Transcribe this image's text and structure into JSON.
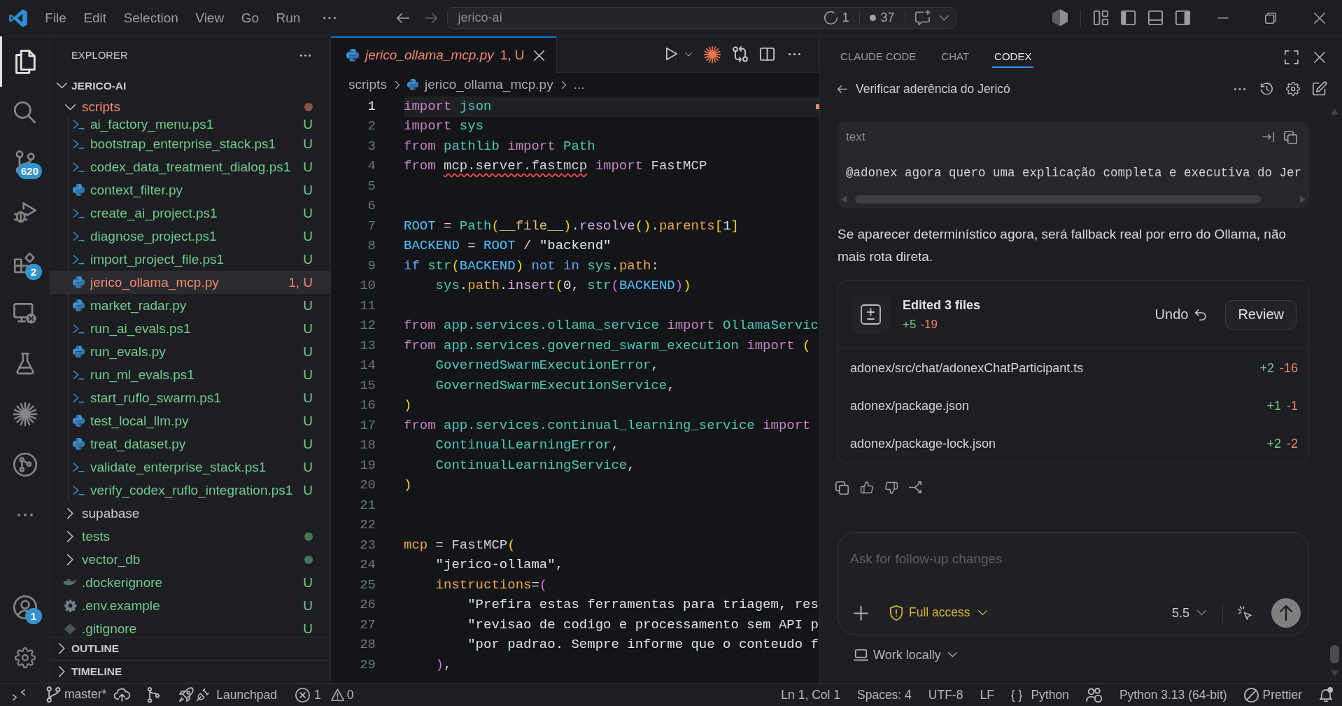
{
  "title_bar": {
    "menu": [
      "File",
      "Edit",
      "Selection",
      "View",
      "Go",
      "Run"
    ],
    "command_center": {
      "text": "jerico-ai",
      "indicators": [
        {
          "kind": "ring",
          "label": "1"
        },
        {
          "kind": "dot",
          "label": "37"
        }
      ]
    }
  },
  "activity_bar": {
    "items": [
      {
        "kind": "files",
        "selected": true
      },
      {
        "kind": "search",
        "selected": false
      },
      {
        "kind": "source-control",
        "selected": false,
        "badge": "620"
      },
      {
        "kind": "run-debug",
        "selected": false
      },
      {
        "kind": "extensions",
        "selected": false,
        "badge": "2"
      },
      {
        "kind": "remote",
        "selected": false
      },
      {
        "kind": "testing",
        "selected": false
      },
      {
        "kind": "starburst",
        "selected": false
      },
      {
        "kind": "graph",
        "selected": false
      },
      {
        "kind": "more",
        "selected": false
      }
    ],
    "bottom_items": [
      {
        "kind": "account",
        "selected": false,
        "badge": "1"
      },
      {
        "kind": "settings",
        "selected": false
      }
    ]
  },
  "explorer": {
    "title": "EXPLORER",
    "root": {
      "label": "JERICO-AI",
      "expanded": true,
      "children": [
        {
          "label": "scripts",
          "kind": "folder",
          "expanded": true,
          "has_changes": true,
          "selected": false,
          "color": "#f48771",
          "children": [
            {
              "label": "ai_factory_menu.ps1",
              "kind": "powershell",
              "status": "U",
              "selected": false,
              "color": "#73c991"
            },
            {
              "label": "bootstrap_enterprise_stack.ps1",
              "kind": "powershell",
              "status": "U",
              "selected": false,
              "color": "#73c991"
            },
            {
              "label": "codex_data_treatment_dialog.ps1",
              "kind": "powershell",
              "status": "U",
              "selected": false,
              "color": "#73c991"
            },
            {
              "label": "context_filter.py",
              "kind": "python",
              "status": "U",
              "selected": false,
              "color": "#73c991"
            },
            {
              "label": "create_ai_project.ps1",
              "kind": "powershell",
              "status": "U",
              "selected": false,
              "color": "#73c991"
            },
            {
              "label": "diagnose_project.ps1",
              "kind": "powershell",
              "status": "U",
              "selected": false,
              "color": "#73c991"
            },
            {
              "label": "import_project_file.ps1",
              "kind": "powershell",
              "status": "U",
              "selected": false,
              "color": "#73c991"
            },
            {
              "label": "jerico_ollama_mcp.py",
              "kind": "python",
              "status": "1, U",
              "selected": true,
              "color": "#f48771"
            },
            {
              "label": "market_radar.py",
              "kind": "python",
              "status": "U",
              "selected": false,
              "color": "#73c991"
            },
            {
              "label": "run_ai_evals.ps1",
              "kind": "powershell",
              "status": "U",
              "selected": false,
              "color": "#73c991"
            },
            {
              "label": "run_evals.py",
              "kind": "python",
              "status": "U",
              "selected": false,
              "color": "#73c991"
            },
            {
              "label": "run_ml_evals.ps1",
              "kind": "powershell",
              "status": "U",
              "selected": false,
              "color": "#73c991"
            },
            {
              "label": "start_ruflo_swarm.ps1",
              "kind": "powershell",
              "status": "U",
              "selected": false,
              "color": "#73c991"
            },
            {
              "label": "test_local_llm.py",
              "kind": "python",
              "status": "U",
              "selected": false,
              "color": "#73c991"
            },
            {
              "label": "treat_dataset.py",
              "kind": "python",
              "status": "U",
              "selected": false,
              "color": "#73c991"
            },
            {
              "label": "validate_enterprise_stack.ps1",
              "kind": "powershell",
              "status": "U",
              "selected": false,
              "color": "#73c991"
            },
            {
              "label": "verify_codex_ruflo_integration.ps1",
              "kind": "powershell",
              "status": "U",
              "selected": false,
              "color": "#73c991"
            }
          ]
        },
        {
          "label": "supabase",
          "kind": "folder",
          "expanded": false,
          "has_changes": false,
          "selected": false,
          "color": "#cccccc"
        },
        {
          "label": "tests",
          "kind": "folder",
          "expanded": false,
          "has_changes": true,
          "selected": false,
          "color": "#73c991"
        },
        {
          "label": "vector_db",
          "kind": "folder",
          "expanded": false,
          "has_changes": true,
          "selected": false,
          "color": "#73c991"
        },
        {
          "label": ".dockerignore",
          "kind": "docker",
          "status": "U",
          "selected": false,
          "color": "#73c991"
        },
        {
          "label": ".env.example",
          "kind": "config",
          "status": "U",
          "selected": false,
          "color": "#73c991"
        },
        {
          "label": ".gitignore",
          "kind": "git",
          "status": "U",
          "selected": false,
          "color": "#73c991"
        }
      ]
    },
    "sections": [
      {
        "label": "OUTLINE",
        "expanded": false
      },
      {
        "label": "TIMELINE",
        "expanded": false
      }
    ]
  },
  "editor": {
    "tabs": [
      {
        "label": "jerico_ollama_mcp.py",
        "kind": "python",
        "badge": "1, U",
        "selected": true,
        "preview": true,
        "color": "#f48771"
      }
    ],
    "breadcrumbs": [
      {
        "label": "scripts",
        "kind": "folder"
      },
      {
        "label": "jerico_ollama_mcp.py",
        "kind": "python"
      },
      {
        "label": "...",
        "kind": "symbols"
      }
    ],
    "lines": [
      {
        "number": "1",
        "current": true,
        "tokens": [
          {
            "text": "import",
            "kind": "keyword"
          },
          {
            "text": " json",
            "kind": "module"
          }
        ]
      },
      {
        "number": "2",
        "current": false,
        "tokens": [
          {
            "text": "import",
            "kind": "keyword"
          },
          {
            "text": " sys",
            "kind": "module"
          }
        ]
      },
      {
        "number": "3",
        "current": false,
        "tokens": [
          {
            "text": "from",
            "kind": "keyword"
          },
          {
            "text": " pathlib",
            "kind": "module"
          },
          {
            "text": " import",
            "kind": "keyword"
          },
          {
            "text": " Path",
            "kind": "class"
          }
        ]
      },
      {
        "number": "4",
        "current": false,
        "tokens": [
          {
            "text": "from ",
            "kind": "keyword"
          },
          {
            "text": "mcp.server.fastmcp",
            "kind": "unresolved"
          },
          {
            "text": " import",
            "kind": "keyword"
          },
          {
            "text": " FastMCP",
            "kind": "plain"
          }
        ]
      },
      {
        "number": "5",
        "current": false
      },
      {
        "number": "6",
        "current": false
      },
      {
        "number": "7",
        "current": false,
        "tokens": [
          {
            "text": "ROOT",
            "kind": "constant"
          },
          {
            "text": " = ",
            "kind": "plain"
          },
          {
            "text": "Path",
            "kind": "class"
          },
          {
            "text": "(",
            "kind": "bracket"
          },
          {
            "text": "__file__",
            "kind": "dunder"
          },
          {
            "text": ")",
            "kind": "bracket"
          },
          {
            "text": ".",
            "kind": "plain"
          },
          {
            "text": "resolve",
            "kind": "method"
          },
          {
            "text": "()",
            "kind": "bracket"
          },
          {
            "text": ".",
            "kind": "plain"
          },
          {
            "text": "parents",
            "kind": "property"
          },
          {
            "text": "[",
            "kind": "bracket"
          },
          {
            "text": "1",
            "kind": "number"
          },
          {
            "text": "]",
            "kind": "bracket"
          }
        ]
      },
      {
        "number": "8",
        "current": false,
        "tokens": [
          {
            "text": "BACKEND",
            "kind": "constant"
          },
          {
            "text": " = ",
            "kind": "plain"
          },
          {
            "text": "ROOT",
            "kind": "constant"
          },
          {
            "text": " / ",
            "kind": "plain"
          },
          {
            "text": "\"backend\"",
            "kind": "string"
          }
        ]
      },
      {
        "number": "9",
        "current": false,
        "tokens": [
          {
            "text": "if",
            "kind": "control"
          },
          {
            "text": " str",
            "kind": "class"
          },
          {
            "text": "(",
            "kind": "bracket"
          },
          {
            "text": "BACKEND",
            "kind": "constant"
          },
          {
            "text": ")",
            "kind": "bracket"
          },
          {
            "text": " not in",
            "kind": "control"
          },
          {
            "text": " sys",
            "kind": "module"
          },
          {
            "text": ".",
            "kind": "plain"
          },
          {
            "text": "path",
            "kind": "property"
          },
          {
            "text": ":",
            "kind": "plain"
          }
        ]
      },
      {
        "number": "10",
        "current": false,
        "tokens": [
          {
            "text": "    sys",
            "kind": "module"
          },
          {
            "text": ".",
            "kind": "plain"
          },
          {
            "text": "path",
            "kind": "property"
          },
          {
            "text": ".",
            "kind": "plain"
          },
          {
            "text": "insert",
            "kind": "method"
          },
          {
            "text": "(",
            "kind": "bracket"
          },
          {
            "text": "0",
            "kind": "number"
          },
          {
            "text": ", ",
            "kind": "plain"
          },
          {
            "text": "str",
            "kind": "class"
          },
          {
            "text": "(",
            "kind": "bracket-nested"
          },
          {
            "text": "BACKEND",
            "kind": "constant"
          },
          {
            "text": ")",
            "kind": "bracket-nested"
          },
          {
            "text": ")",
            "kind": "bracket"
          }
        ]
      },
      {
        "number": "11",
        "current": false
      },
      {
        "number": "12",
        "current": false,
        "tokens": [
          {
            "text": "from",
            "kind": "keyword"
          },
          {
            "text": " app.services.ollama_service",
            "kind": "module"
          },
          {
            "text": " import",
            "kind": "keyword"
          },
          {
            "text": " OllamaServic",
            "kind": "class"
          }
        ]
      },
      {
        "number": "13",
        "current": false,
        "tokens": [
          {
            "text": "from",
            "kind": "keyword"
          },
          {
            "text": " app.services.governed_swarm_execution",
            "kind": "module"
          },
          {
            "text": " import",
            "kind": "keyword"
          },
          {
            "text": " (",
            "kind": "bracket"
          }
        ]
      },
      {
        "number": "14",
        "current": false,
        "tokens": [
          {
            "text": "    GovernedSwarmExecutionError",
            "kind": "class"
          },
          {
            "text": ",",
            "kind": "plain"
          }
        ]
      },
      {
        "number": "15",
        "current": false,
        "tokens": [
          {
            "text": "    GovernedSwarmExecutionService",
            "kind": "class"
          },
          {
            "text": ",",
            "kind": "plain"
          }
        ]
      },
      {
        "number": "16",
        "current": false,
        "tokens": [
          {
            "text": ")",
            "kind": "bracket"
          }
        ]
      },
      {
        "number": "17",
        "current": false,
        "tokens": [
          {
            "text": "from",
            "kind": "keyword"
          },
          {
            "text": " app.services.continual_learning_service",
            "kind": "module"
          },
          {
            "text": " import",
            "kind": "keyword"
          }
        ]
      },
      {
        "number": "18",
        "current": false,
        "tokens": [
          {
            "text": "    ContinualLearningError",
            "kind": "class"
          },
          {
            "text": ",",
            "kind": "plain"
          }
        ]
      },
      {
        "number": "19",
        "current": false,
        "tokens": [
          {
            "text": "    ContinualLearningService",
            "kind": "class"
          },
          {
            "text": ",",
            "kind": "plain"
          }
        ]
      },
      {
        "number": "20",
        "current": false,
        "tokens": [
          {
            "text": ")",
            "kind": "bracket"
          }
        ]
      },
      {
        "number": "21",
        "current": false
      },
      {
        "number": "22",
        "current": false
      },
      {
        "number": "23",
        "current": false,
        "tokens": [
          {
            "text": "mcp",
            "kind": "property"
          },
          {
            "text": " = FastMCP",
            "kind": "plain"
          },
          {
            "text": "(",
            "kind": "bracket"
          }
        ]
      },
      {
        "number": "24",
        "current": false,
        "tokens": [
          {
            "text": "    \"jerico-ollama\"",
            "kind": "string"
          },
          {
            "text": ",",
            "kind": "plain"
          }
        ]
      },
      {
        "number": "25",
        "current": false,
        "tokens": [
          {
            "text": "    instructions",
            "kind": "property"
          },
          {
            "text": "=",
            "kind": "plain"
          },
          {
            "text": "(",
            "kind": "bracket-nested"
          }
        ]
      },
      {
        "number": "26",
        "current": false,
        "tokens": [
          {
            "text": "        \"Prefira estas ferramentas para triagem, res",
            "kind": "string"
          }
        ]
      },
      {
        "number": "27",
        "current": false,
        "tokens": [
          {
            "text": "        \"revisao de codigo e processamento sem API p",
            "kind": "string"
          }
        ]
      },
      {
        "number": "28",
        "current": false,
        "tokens": [
          {
            "text": "        \"por padrao. Sempre informe que o conteudo f",
            "kind": "string"
          }
        ]
      },
      {
        "number": "29",
        "current": false,
        "tokens": [
          {
            "text": "    )",
            "kind": "bracket-nested"
          },
          {
            "text": ",",
            "kind": "plain"
          }
        ]
      }
    ]
  },
  "agent_panel": {
    "tabs": [
      {
        "label": "CLAUDE CODE",
        "selected": false
      },
      {
        "label": "CHAT",
        "selected": false
      },
      {
        "label": "CODEX",
        "selected": true
      }
    ],
    "thread": {
      "title": "Verificar aderência do Jericó"
    },
    "code_block": {
      "language": "text",
      "code": "@adonex agora quero uma explicação completa e executiva do Jer"
    },
    "message": "Se aparecer determinístico agora, será fallback real por erro do Ollama, não mais rota direta.",
    "changes": {
      "title": "Edited 3 files",
      "added": "+5",
      "removed": "-19",
      "undo": "Undo",
      "review": "Review",
      "files": [
        {
          "path": "adonex/src/chat/adonexChatParticipant.ts",
          "added": "+2",
          "removed": "-16"
        },
        {
          "path": "adonex/package.json",
          "added": "+1",
          "removed": "-1"
        },
        {
          "path": "adonex/package-lock.json",
          "added": "+2",
          "removed": "-2"
        }
      ]
    },
    "composer": {
      "placeholder": "Ask for follow-up changes",
      "access": "Full access",
      "model": "5.5"
    },
    "environment": "Work locally"
  },
  "status_bar": {
    "left": [
      {
        "kind": "remote"
      },
      {
        "kind": "branch",
        "label": "master*"
      },
      {
        "kind": "publish"
      },
      {
        "kind": "graph"
      },
      {
        "kind": "launchpad",
        "label": "Launchpad"
      },
      {
        "kind": "problems",
        "errors": "1",
        "warnings": "0"
      }
    ],
    "right": [
      {
        "kind": "position",
        "label": "Ln 1, Col 1"
      },
      {
        "kind": "indentation",
        "label": "Spaces: 4"
      },
      {
        "kind": "encoding",
        "label": "UTF-8"
      },
      {
        "kind": "line-ending",
        "label": "LF"
      },
      {
        "kind": "language",
        "symbol": "{ }",
        "label": "Python"
      },
      {
        "kind": "copilot"
      },
      {
        "kind": "interpreter",
        "label": "Python 3.13 (64-bit)"
      },
      {
        "kind": "formatter",
        "label": "Prettier"
      },
      {
        "kind": "notifications"
      }
    ]
  }
}
